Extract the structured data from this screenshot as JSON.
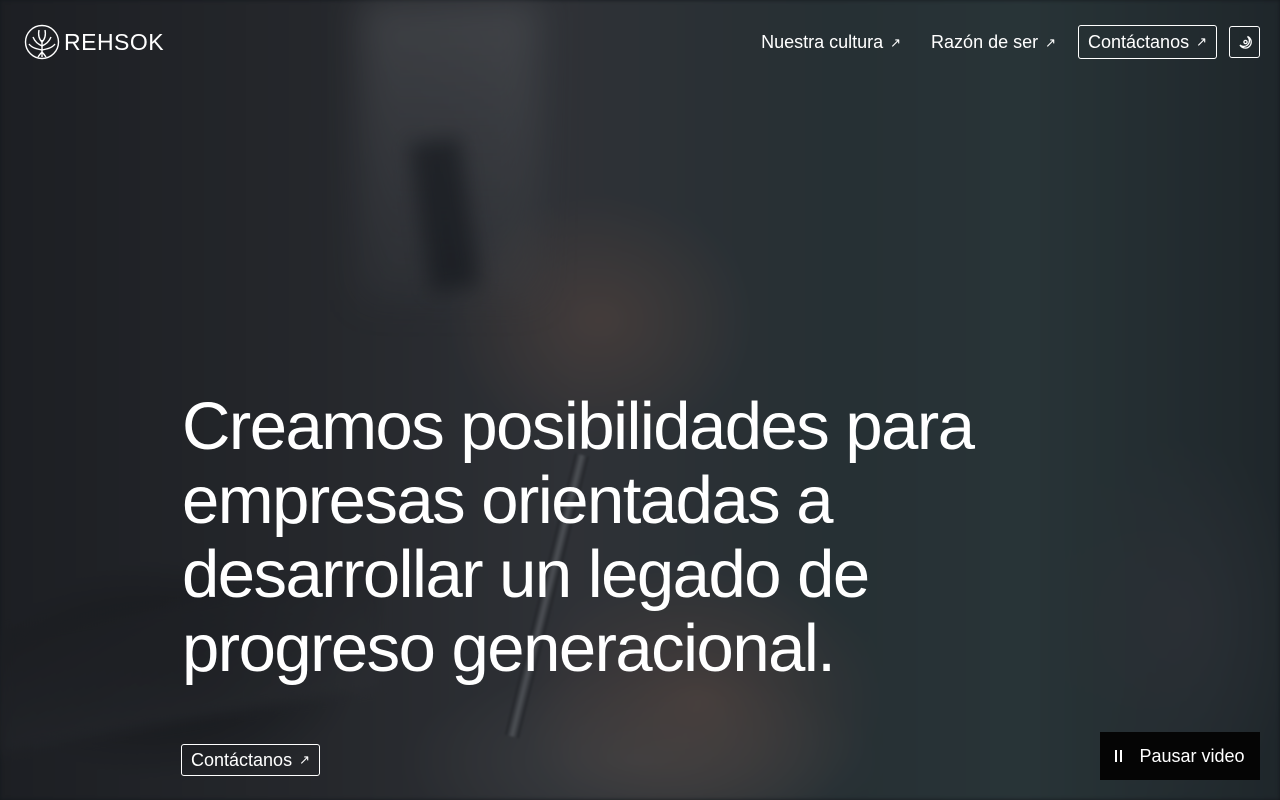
{
  "brand": {
    "name": "REHSOK"
  },
  "nav": {
    "items": [
      {
        "label": "Nuestra cultura"
      },
      {
        "label": "Razón de ser"
      }
    ],
    "contact_label": "Contáctanos",
    "theme_toggle_icon": "moon-sun-icon"
  },
  "hero": {
    "headline": "Creamos posibilidades para empresas orientadas a desarrollar un legado de progreso generacional.",
    "cta_label": "Contáctanos"
  },
  "video": {
    "pause_label": "Pausar video",
    "pause_icon": "pause-icon"
  },
  "icons": {
    "external_arrow": "↗"
  },
  "colors": {
    "text": "#ffffff",
    "pause_button_bg": "#050505"
  }
}
